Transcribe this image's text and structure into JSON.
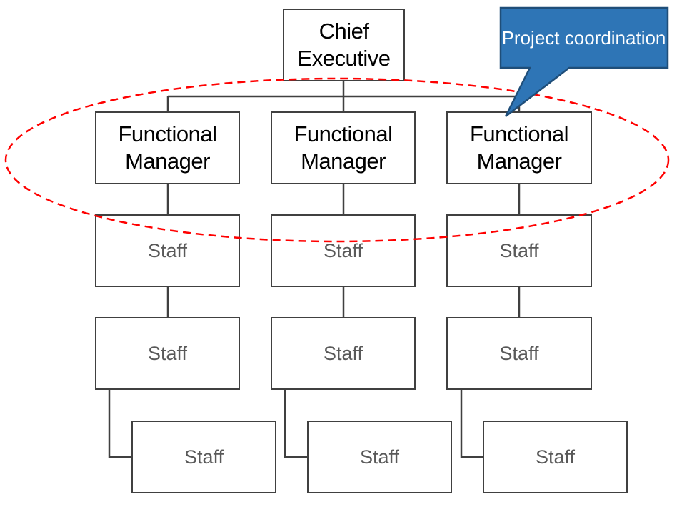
{
  "chief": "Chief Executive",
  "managers": [
    "Functional Manager",
    "Functional Manager",
    "Functional Manager"
  ],
  "staff_rows": [
    [
      "Staff",
      "Staff",
      "Staff"
    ],
    [
      "Staff",
      "Staff",
      "Staff"
    ],
    [
      "Staff",
      "Staff",
      "Staff"
    ]
  ],
  "callout": "Project coordination",
  "colors": {
    "callout_fill": "#2E75B6",
    "callout_border": "#1F4E79",
    "ellipse": "#FF0000",
    "lines": "#404040"
  }
}
